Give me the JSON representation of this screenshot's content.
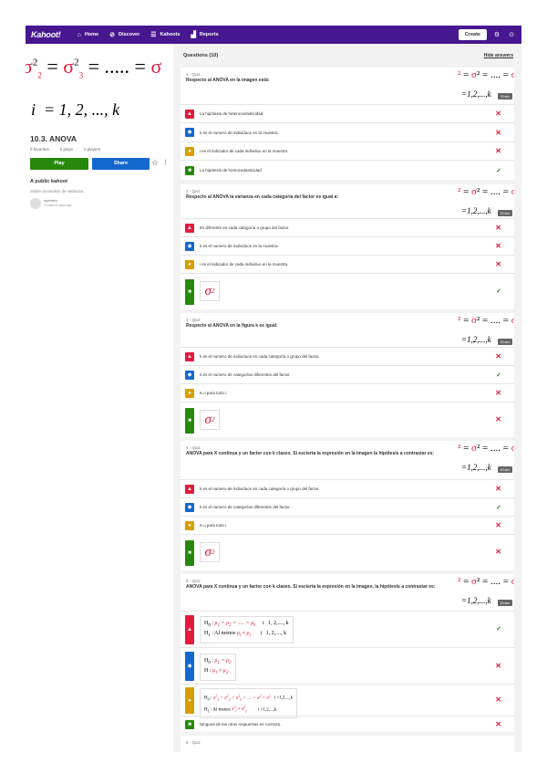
{
  "nav": {
    "logo": "Kahoot!",
    "items": [
      {
        "label": "Home",
        "icon": "home-icon",
        "glyph": "⌂"
      },
      {
        "label": "Discover",
        "icon": "compass-icon",
        "glyph": "⊘"
      },
      {
        "label": "Kahoots",
        "icon": "list-icon",
        "glyph": "☰"
      },
      {
        "label": "Reports",
        "icon": "chart-icon",
        "glyph": "▟"
      }
    ],
    "create": "Create"
  },
  "kahoot": {
    "title": "10.3. ANOVA",
    "favorites": "0 favorites",
    "plays": "0 plays",
    "players": "0 players",
    "play": "Play",
    "share": "Share",
    "visibility": "A public kahoot",
    "description": "Sobre ammelisis de varianza.",
    "author": "rsprimero",
    "created": "Created 6 days ago"
  },
  "questions_header": {
    "title": "Questions (10)",
    "toggle": "Hide answers"
  },
  "questions": [
    {
      "type": "1 - Quiz",
      "text": "Respecto al ANOVA en la imagen está:",
      "time": "20 sec",
      "answers": [
        {
          "text": "La hipótesis de heterocedasticidad",
          "correct": false
        },
        {
          "text": "k es el numero de individuos en la muestra.",
          "correct": false
        },
        {
          "text": "i es el indicador de cada individuo en la muestra.",
          "correct": false
        },
        {
          "text": "La hipótesis de homocedasticidad",
          "correct": true
        }
      ]
    },
    {
      "type": "2 - Quiz",
      "text": "Respecto al ANOVA la varianza en cada categoría del factor es igual a:",
      "time": "20 sec",
      "answers": [
        {
          "text": "Es diferente en cada categoría o grupo del factor.",
          "correct": false
        },
        {
          "text": "k es el numero de individuos en la muestra.",
          "correct": false
        },
        {
          "text": "i es el indicador de cada individuo en la muestra.",
          "correct": false
        },
        {
          "text": "",
          "correct": true
        }
      ]
    },
    {
      "type": "3 - Quiz",
      "text": "Respecto al ANOVA en la figura k es igual:",
      "time": "20 sec",
      "answers": [
        {
          "text": "k es el numero de individuos en cada categoría o grupo del factor.",
          "correct": false
        },
        {
          "text": "k es el numero de categorías diferentes del factor.",
          "correct": true
        },
        {
          "text": "K=i para todo i.",
          "correct": false
        },
        {
          "text": "",
          "correct": false
        }
      ]
    },
    {
      "type": "4 - Quiz",
      "text": "ANOVA para X continua y un factor con k clases. Si escierta la expresión en la imagen la hipótesis a contrastar es:",
      "time": "20 sec",
      "answers": [
        {
          "text": "k es el numero de individuos en cada categoría o grupo del factor.",
          "correct": false
        },
        {
          "text": "k es el numero de categorías diferentes del factor.",
          "correct": true
        },
        {
          "text": "K=i para todo i.",
          "correct": false
        },
        {
          "text": "",
          "correct": false
        }
      ]
    },
    {
      "type": "5 - Quiz",
      "text": "ANOVA para X continua y un factor con k clases. Si escierta la expresión en la imagen, la hipótesis a contrastar es:",
      "time": "20 sec",
      "answers": [
        {
          "text": "",
          "correct": true
        },
        {
          "text": "",
          "correct": false
        },
        {
          "text": "",
          "correct": false
        },
        {
          "text": "Ninguna de las otras respuestas es correcta.",
          "correct": false
        }
      ]
    }
  ],
  "next_question": {
    "type": "6 - Quiz"
  },
  "colors": {
    "nav": "#46178f",
    "red": "#e21b3c",
    "blue": "#1368ce",
    "yellow": "#d89e00",
    "green": "#26890c"
  }
}
